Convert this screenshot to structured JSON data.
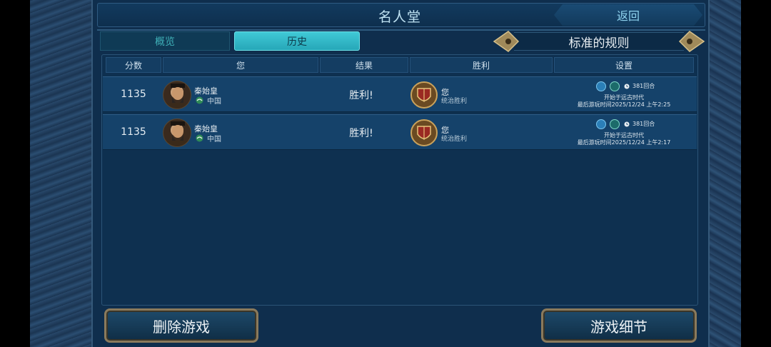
{
  "header": {
    "title": "名人堂",
    "back_label": "返回"
  },
  "tabs": [
    {
      "label": "概览",
      "active": false
    },
    {
      "label": "历史",
      "active": true
    }
  ],
  "ruleset": {
    "label": "标准的规则"
  },
  "table": {
    "columns": [
      "分数",
      "您",
      "结果",
      "胜利",
      "设置"
    ],
    "rows": [
      {
        "score": "1135",
        "leader": "秦始皇",
        "civ": "中国",
        "result": "胜利!",
        "victory_who": "您",
        "victory_type": "统治胜利",
        "turns": "381回合",
        "start_era": "开始于远古时代",
        "last_played": "最后游玩时间2025/12/24 上午2:25"
      },
      {
        "score": "1135",
        "leader": "秦始皇",
        "civ": "中国",
        "result": "胜利!",
        "victory_who": "您",
        "victory_type": "统治胜利",
        "turns": "381回合",
        "start_era": "开始于远古时代",
        "last_played": "最后游玩时间2025/12/24 上午2:17"
      }
    ]
  },
  "buttons": {
    "delete_label": "删除游戏",
    "details_label": "游戏细节"
  },
  "colors": {
    "accent_cyan": "#40c9d6",
    "panel": "#0f2e4d",
    "gold_frame": "#8a7a5c"
  }
}
